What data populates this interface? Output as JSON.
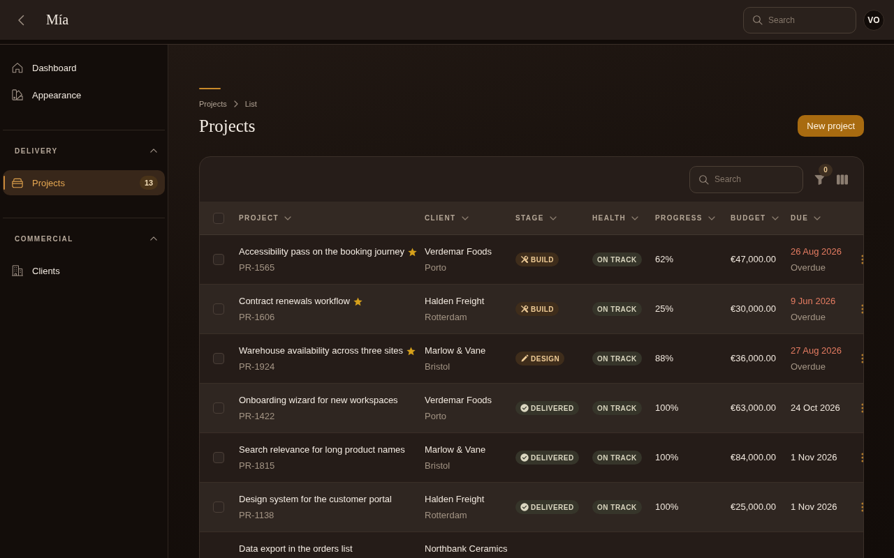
{
  "header": {
    "logo": "Mía",
    "search": {
      "placeholder": "Search"
    },
    "avatar": "VO"
  },
  "sidebar": {
    "items": [
      {
        "label": "Dashboard",
        "selected": false
      },
      {
        "label": "Appearance",
        "selected": false
      }
    ],
    "sections": [
      {
        "title": "DELIVERY",
        "expanded": true,
        "items": [
          {
            "label": "Projects",
            "selected": true,
            "count": "13"
          }
        ]
      },
      {
        "title": "COMMERCIAL",
        "expanded": true,
        "items": [
          {
            "label": "Clients",
            "selected": false
          }
        ]
      }
    ]
  },
  "page": {
    "breadcrumb": [
      "Projects",
      "List"
    ],
    "title": "Projects",
    "primary_button": "New project"
  },
  "table": {
    "search": {
      "placeholder": "Search"
    },
    "filter_count": "0",
    "select_all": {
      "checked": false
    },
    "columns": [
      {
        "label": "PROJECT"
      },
      {
        "label": "CLIENT"
      },
      {
        "label": "STAGE"
      },
      {
        "label": "HEALTH"
      },
      {
        "label": "PROGRESS"
      },
      {
        "label": "BUDGET"
      },
      {
        "label": "DUE"
      }
    ],
    "rows": [
      {
        "selected": false,
        "name": "Accessibility pass on the booking journey",
        "starred": true,
        "code": "PR-1565",
        "client": "Verdemar Foods",
        "city": "Porto",
        "stage": {
          "label": "BUILD",
          "kind": "build"
        },
        "health": "ON TRACK",
        "progress": "62%",
        "budget": "€47,000.00",
        "due": "26 Aug 2026",
        "overdue": true,
        "due_note": "Overdue"
      },
      {
        "selected": false,
        "name": "Contract renewals workflow",
        "starred": true,
        "code": "PR-1606",
        "client": "Halden Freight",
        "city": "Rotterdam",
        "stage": {
          "label": "BUILD",
          "kind": "build"
        },
        "health": "ON TRACK",
        "progress": "25%",
        "budget": "€30,000.00",
        "due": "9 Jun 2026",
        "overdue": true,
        "due_note": "Overdue"
      },
      {
        "selected": false,
        "name": "Warehouse availability across three sites",
        "starred": true,
        "code": "PR-1924",
        "client": "Marlow & Vane",
        "city": "Bristol",
        "stage": {
          "label": "DESIGN",
          "kind": "design"
        },
        "health": "ON TRACK",
        "progress": "88%",
        "budget": "€36,000.00",
        "due": "27 Aug 2026",
        "overdue": true,
        "due_note": "Overdue"
      },
      {
        "selected": false,
        "name": "Onboarding wizard for new workspaces",
        "starred": false,
        "code": "PR-1422",
        "client": "Verdemar Foods",
        "city": "Porto",
        "stage": {
          "label": "DELIVERED",
          "kind": "delivered"
        },
        "health": "ON TRACK",
        "progress": "100%",
        "budget": "€63,000.00",
        "due": "24 Oct 2026",
        "overdue": false
      },
      {
        "selected": false,
        "name": "Search relevance for long product names",
        "starred": false,
        "code": "PR-1815",
        "client": "Marlow & Vane",
        "city": "Bristol",
        "stage": {
          "label": "DELIVERED",
          "kind": "delivered"
        },
        "health": "ON TRACK",
        "progress": "100%",
        "budget": "€84,000.00",
        "due": "1 Nov 2026",
        "overdue": false
      },
      {
        "selected": false,
        "name": "Design system for the customer portal",
        "starred": false,
        "code": "PR-1138",
        "client": "Halden Freight",
        "city": "Rotterdam",
        "stage": {
          "label": "DELIVERED",
          "kind": "delivered"
        },
        "health": "ON TRACK",
        "progress": "100%",
        "budget": "€25,000.00",
        "due": "1 Nov 2026",
        "overdue": false
      },
      {
        "name": "Data export in the orders list",
        "client": "Northbank Ceramics"
      }
    ]
  }
}
